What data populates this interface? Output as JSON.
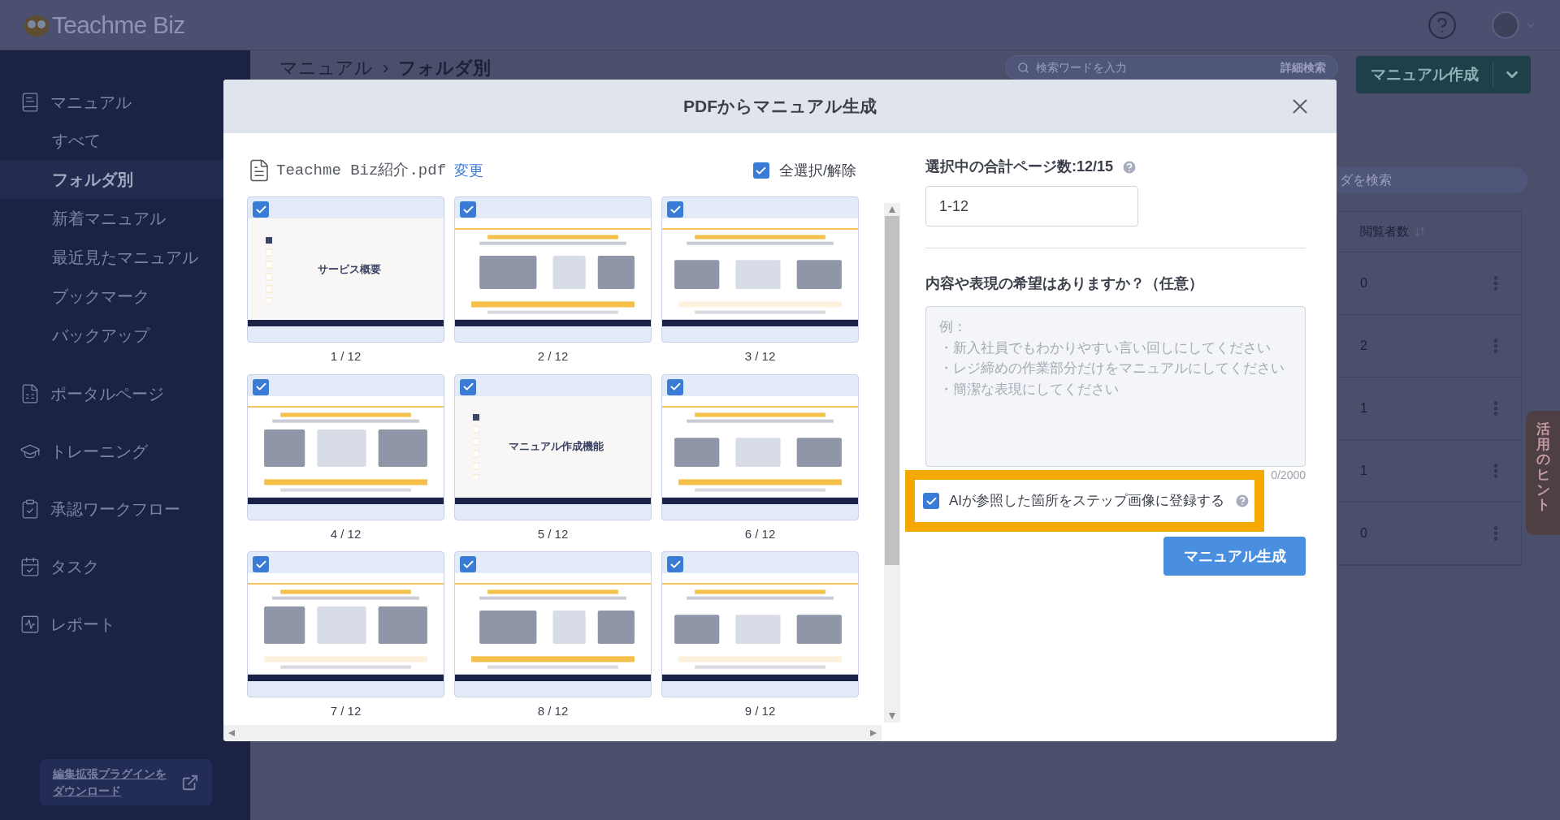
{
  "header": {
    "logo": "Teachme Biz"
  },
  "sidebar": {
    "sections": [
      {
        "label": "マニュアル",
        "children": [
          {
            "label": "すべて",
            "selected": false
          },
          {
            "label": "フォルダ別",
            "selected": true
          },
          {
            "label": "新着マニュアル",
            "selected": false
          },
          {
            "label": "最近見たマニュアル",
            "selected": false
          },
          {
            "label": "ブックマーク",
            "selected": false
          },
          {
            "label": "バックアップ",
            "selected": false
          }
        ]
      },
      {
        "label": "ポータルページ"
      },
      {
        "label": "トレーニング"
      },
      {
        "label": "承認ワークフロー"
      },
      {
        "label": "タスク"
      },
      {
        "label": "レポート"
      }
    ],
    "plugin_link": {
      "lines": [
        "編集拡張プラグインを",
        "ダウンロード"
      ]
    }
  },
  "toolbar": {
    "breadcrumb": {
      "parent": "マニュアル",
      "separator": "›",
      "current": "フォルダ別"
    },
    "search": {
      "placeholder": "検索ワードを入力",
      "advanced": "詳細検索"
    },
    "create_button": "マニュアル作成"
  },
  "folder_search": {
    "placeholder": "ダを検索"
  },
  "table": {
    "column": "閲覧者数",
    "rows": [
      {
        "views": "0"
      },
      {
        "views": "2"
      },
      {
        "views": "1"
      },
      {
        "views": "1"
      },
      {
        "views": "0"
      }
    ]
  },
  "side_tab": {
    "label": "活用のヒント"
  },
  "dialog": {
    "title": "PDFからマニュアル生成",
    "file": {
      "name": "Teachme Biz紹介.pdf",
      "change_link": "変更"
    },
    "select_all": {
      "label": "全選択/解除",
      "checked": true
    },
    "pages": [
      {
        "label": "1 / 12",
        "checked": true,
        "kind": "cover",
        "title": "サービス概要"
      },
      {
        "label": "2 / 12",
        "checked": true,
        "kind": "content"
      },
      {
        "label": "3 / 12",
        "checked": true,
        "kind": "content"
      },
      {
        "label": "4 / 12",
        "checked": true,
        "kind": "content"
      },
      {
        "label": "5 / 12",
        "checked": true,
        "kind": "cover",
        "title": "マニュアル作成機能"
      },
      {
        "label": "6 / 12",
        "checked": true,
        "kind": "content"
      },
      {
        "label": "7 / 12",
        "checked": true,
        "kind": "content"
      },
      {
        "label": "8 / 12",
        "checked": true,
        "kind": "content"
      },
      {
        "label": "9 / 12",
        "checked": true,
        "kind": "content"
      }
    ],
    "page_count_label": "選択中の合計ページ数:12/15",
    "page_range": {
      "value": "1-12"
    },
    "request_label": "内容や表現の希望はありますか？（任意）",
    "request": {
      "placeholder": [
        "例：",
        "・新入社員でもわかりやすい言い回しにしてください",
        "・レジ締めの作業部分だけをマニュアルにしてください",
        "・簡潔な表現にしてください"
      ],
      "counter": "0/2000"
    },
    "register_images": {
      "label": "AIが参照した箇所をステップ画像に登録する",
      "checked": true
    },
    "generate_button": "マニュアル生成"
  }
}
